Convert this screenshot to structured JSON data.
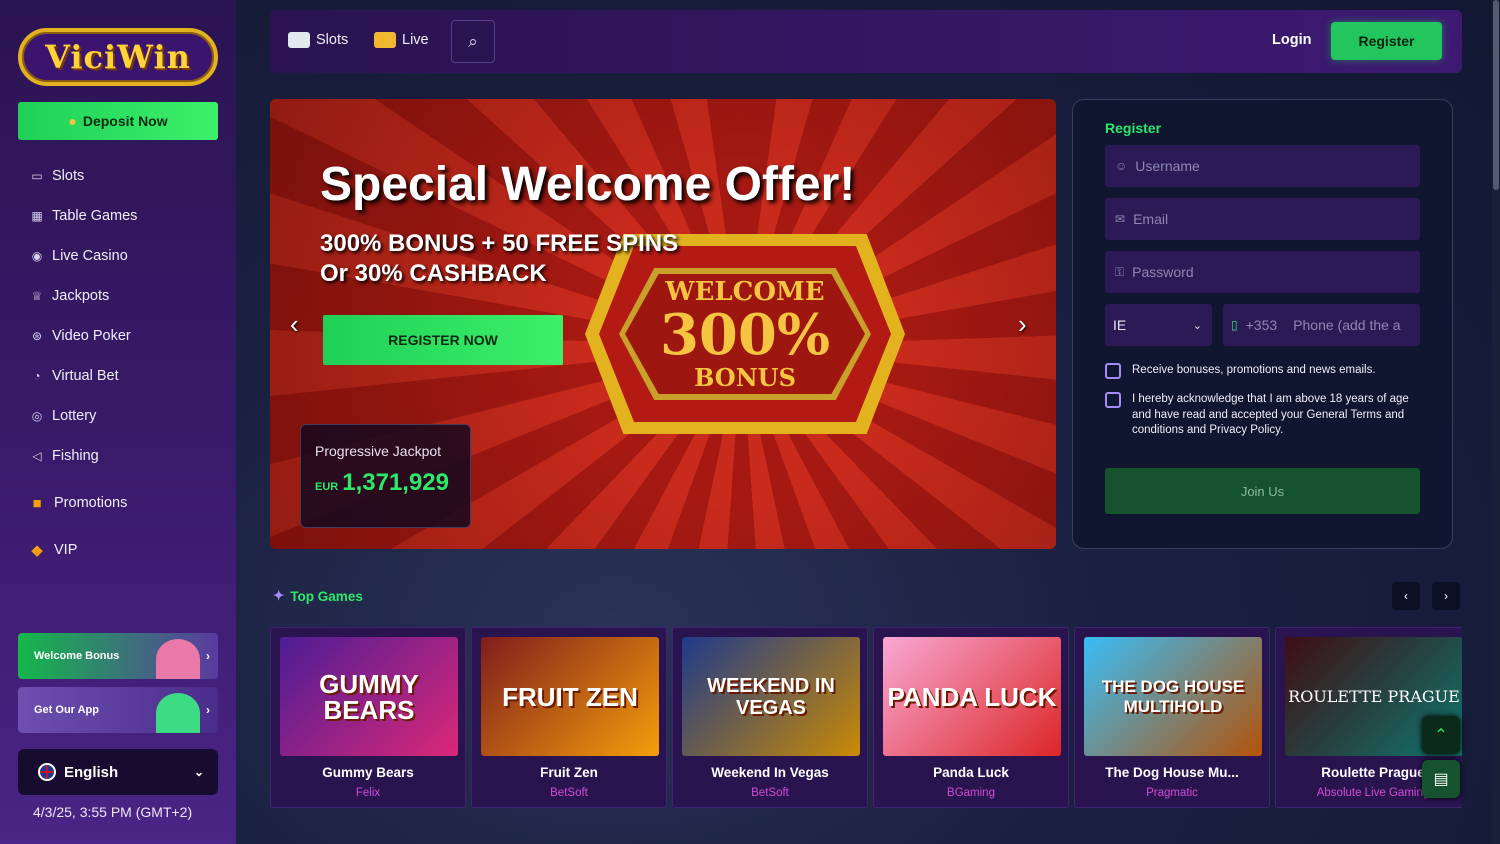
{
  "brand": {
    "logo_text": "ViciWin"
  },
  "sidebar": {
    "deposit_label": "Deposit Now",
    "items": [
      {
        "label": "Slots",
        "icon": "slot-machine-icon"
      },
      {
        "label": "Table Games",
        "icon": "table-icon"
      },
      {
        "label": "Live Casino",
        "icon": "live-icon"
      },
      {
        "label": "Jackpots",
        "icon": "trophy-icon"
      },
      {
        "label": "Video Poker",
        "icon": "poker-chip-icon"
      },
      {
        "label": "Virtual Bet",
        "icon": "virtual-icon"
      },
      {
        "label": "Lottery",
        "icon": "lottery-icon"
      },
      {
        "label": "Fishing",
        "icon": "fish-icon"
      },
      {
        "label": "Promotions",
        "icon": "gift-icon"
      },
      {
        "label": "VIP",
        "icon": "diamond-icon"
      }
    ],
    "welcome_bonus_label": "Welcome Bonus",
    "get_app_label": "Get Our App",
    "language": "English",
    "datetime": "4/3/25, 3:55 PM (GMT+2)"
  },
  "topbar": {
    "slots_label": "Slots",
    "live_label": "Live",
    "login_label": "Login",
    "register_label": "Register"
  },
  "banner": {
    "title": "Special Welcome Offer!",
    "subtitle_line1": "300% BONUS + 50 FREE SPINS",
    "subtitle_line2": "Or 30% CASHBACK",
    "cta_label": "REGISTER NOW",
    "machine_welcome": "WELCOME",
    "machine_percent": "300%",
    "machine_bonus": "BONUS",
    "jackpot_label": "Progressive Jackpot",
    "jackpot_currency": "EUR",
    "jackpot_amount": "1,371,929"
  },
  "register_form": {
    "title": "Register",
    "username_placeholder": "Username",
    "email_placeholder": "Email",
    "password_placeholder": "Password",
    "country_code": "IE",
    "phone_prefix": "+353",
    "phone_placeholder": "Phone (add the a",
    "checkbox_promo": "Receive bonuses, promotions and news emails.",
    "checkbox_terms": "I hereby acknowledge that I am above 18 years of age and have read and accepted your General Terms and conditions and Privacy Policy.",
    "join_label": "Join Us"
  },
  "top_games": {
    "title": "Top Games",
    "games": [
      {
        "name": "Gummy Bears",
        "provider": "Felix",
        "art": "GUMMY BEARS"
      },
      {
        "name": "Fruit Zen",
        "provider": "BetSoft",
        "art": "FRUIT ZEN"
      },
      {
        "name": "Weekend In Vegas",
        "provider": "BetSoft",
        "art": "WEEKEND IN VEGAS"
      },
      {
        "name": "Panda Luck",
        "provider": "BGaming",
        "art": "PANDA LUCK"
      },
      {
        "name": "The Dog House Mu...",
        "provider": "Pragmatic",
        "art": "THE DOG HOUSE MULTIHOLD"
      },
      {
        "name": "Roulette Prague",
        "provider": "Absolute Live Gaming",
        "art": "ROULETTE PRAGUE"
      }
    ]
  },
  "colors": {
    "accent": "#22c55e",
    "sidebar": "#3a1a6b",
    "banner_red": "#c82a1c",
    "provider": "#d04cd8"
  }
}
